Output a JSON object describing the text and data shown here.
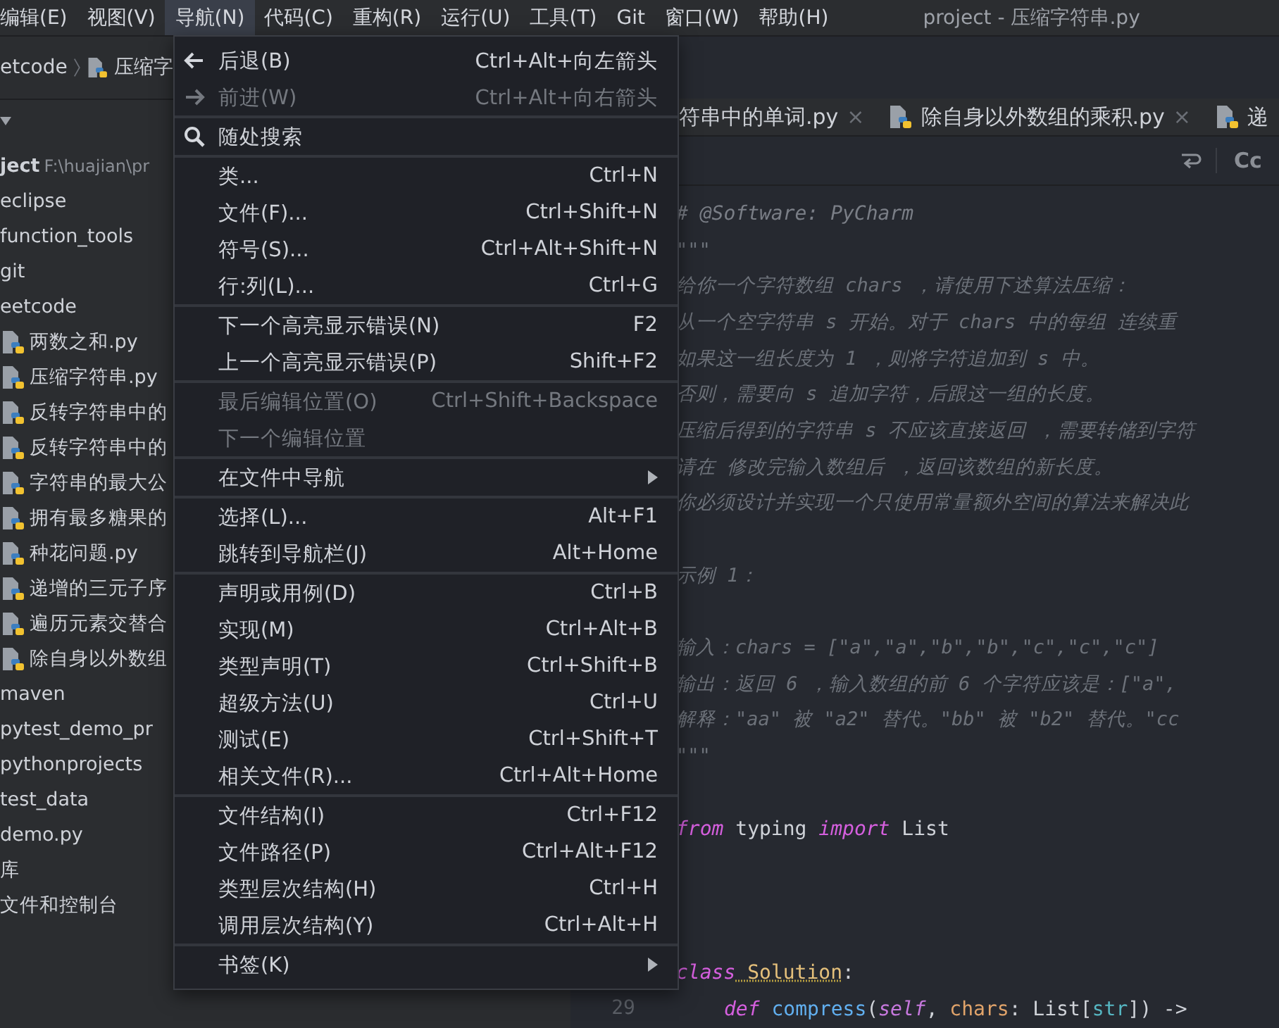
{
  "menu_bar": {
    "items": [
      {
        "label": "编辑(E)",
        "selected": false
      },
      {
        "label": "视图(V)",
        "selected": false
      },
      {
        "label": "导航(N)",
        "selected": true
      },
      {
        "label": "代码(C)",
        "selected": false
      },
      {
        "label": "重构(R)",
        "selected": false
      },
      {
        "label": "运行(U)",
        "selected": false
      },
      {
        "label": "工具(T)",
        "selected": false
      },
      {
        "label": "Git",
        "selected": false
      },
      {
        "label": "窗口(W)",
        "selected": false
      },
      {
        "label": "帮助(H)",
        "selected": false
      }
    ],
    "title": "project - 压缩字符串.py"
  },
  "breadcrumb": [
    "etcode",
    "压缩字"
  ],
  "project_tree": {
    "root": {
      "name": "ject",
      "path": "F:\\huajian\\pr",
      "children": [
        {
          "name": "eclipse"
        },
        {
          "name": "function_tools"
        },
        {
          "name": "git"
        },
        {
          "name": "eetcode",
          "children": [
            {
              "name": "两数之和.py",
              "kind": "python"
            },
            {
              "name": "压缩字符串.py",
              "kind": "python"
            },
            {
              "name": "反转字符串中的",
              "kind": "python"
            },
            {
              "name": "反转字符串中的",
              "kind": "python"
            },
            {
              "name": "字符串的最大公",
              "kind": "python"
            },
            {
              "name": "拥有最多糖果的",
              "kind": "python"
            },
            {
              "name": "种花问题.py",
              "kind": "python"
            },
            {
              "name": "递增的三元子序",
              "kind": "python"
            },
            {
              "name": "遍历元素交替合",
              "kind": "python"
            },
            {
              "name": "除自身以外数组",
              "kind": "python"
            }
          ]
        },
        {
          "name": "maven"
        },
        {
          "name": "pytest_demo_pr"
        },
        {
          "name": "pythonprojects"
        },
        {
          "name": "test_data"
        },
        {
          "name": "demo.py"
        }
      ]
    },
    "extra": [
      {
        "name": "库"
      },
      {
        "name": "文件和控制台"
      }
    ]
  },
  "editor_tabs": [
    {
      "label": "符串中的单词.py",
      "kind": "plain",
      "close": "×"
    },
    {
      "label": "除自身以外数组的乘积.py",
      "kind": "python",
      "close": "×"
    },
    {
      "label": "递",
      "kind": "python"
    }
  ],
  "editor_toolbar": {
    "case_button": "Cc"
  },
  "code": {
    "lines": [
      {
        "kind": "code",
        "tokens": [
          {
            "kind": "comment",
            "text": "# @Software: PyCharm"
          }
        ]
      },
      {
        "kind": "code",
        "tokens": [
          {
            "kind": "doc",
            "text": "\"\"\""
          }
        ]
      },
      {
        "kind": "code",
        "tokens": [
          {
            "kind": "doc",
            "text": "给你一个字符数组 chars ，请使用下述算法压缩："
          }
        ]
      },
      {
        "kind": "code",
        "tokens": [
          {
            "kind": "doc",
            "text": "从一个空字符串 s 开始。对于 chars 中的每组 连续重"
          }
        ]
      },
      {
        "kind": "code",
        "tokens": [
          {
            "kind": "doc",
            "text": "如果这一组长度为 1 ，则将字符追加到 s 中。"
          }
        ]
      },
      {
        "kind": "code",
        "tokens": [
          {
            "kind": "doc",
            "text": "否则，需要向 s 追加字符，后跟这一组的长度。"
          }
        ]
      },
      {
        "kind": "code",
        "tokens": [
          {
            "kind": "doc",
            "text": "压缩后得到的字符串 s 不应该直接返回 ，需要转储到字符"
          }
        ]
      },
      {
        "kind": "code",
        "tokens": [
          {
            "kind": "doc",
            "text": "请在 修改完输入数组后 ，返回该数组的新长度。"
          }
        ]
      },
      {
        "kind": "code",
        "tokens": [
          {
            "kind": "doc",
            "text": "你必须设计并实现一个只使用常量额外空间的算法来解决此"
          }
        ]
      },
      {
        "kind": "blank"
      },
      {
        "kind": "code",
        "tokens": [
          {
            "kind": "doc",
            "text": "示例 1："
          }
        ]
      },
      {
        "kind": "blank"
      },
      {
        "kind": "code",
        "tokens": [
          {
            "kind": "doc",
            "text": "输入：chars = [\"a\",\"a\",\"b\",\"b\",\"c\",\"c\",\"c\"]"
          }
        ]
      },
      {
        "kind": "code",
        "tokens": [
          {
            "kind": "doc",
            "text": "输出：返回 6 ，输入数组的前 6 个字符应该是：[\"a\","
          }
        ]
      },
      {
        "kind": "code",
        "tokens": [
          {
            "kind": "doc",
            "text": "解释：\"aa\" 被 \"a2\" 替代。\"bb\" 被 \"b2\" 替代。\"cc"
          }
        ]
      },
      {
        "kind": "code",
        "tokens": [
          {
            "kind": "doc",
            "text": "\"\"\""
          }
        ]
      },
      {
        "kind": "blank"
      },
      {
        "kind": "code",
        "tokens": [
          {
            "kind": "keyword",
            "text": "from"
          },
          {
            "kind": "plain",
            "text": " typing "
          },
          {
            "kind": "keyword",
            "text": "import"
          },
          {
            "kind": "plain",
            "text": " List"
          }
        ]
      },
      {
        "kind": "blank"
      },
      {
        "kind": "blank"
      },
      {
        "kind": "blank"
      },
      {
        "kind": "code",
        "tokens": [
          {
            "kind": "keyword",
            "text": "class"
          },
          {
            "kind": "classname",
            "text": " Solution"
          },
          {
            "kind": "plain",
            "text": ":"
          }
        ]
      },
      {
        "kind": "indented",
        "number": "29",
        "tokens": [
          {
            "kind": "keyword",
            "text": "def"
          },
          {
            "kind": "function",
            "text": " compress"
          },
          {
            "kind": "plain",
            "text": "("
          },
          {
            "kind": "self",
            "text": "self"
          },
          {
            "kind": "plain",
            "text": ", "
          },
          {
            "kind": "param",
            "text": "chars"
          },
          {
            "kind": "plain",
            "text": ": List["
          },
          {
            "kind": "builtin",
            "text": "str"
          },
          {
            "kind": "plain",
            "text": "]) ->"
          }
        ]
      }
    ]
  },
  "navigate_menu": {
    "groups": [
      {
        "items": [
          {
            "label": "后退(B)",
            "shortcut": "Ctrl+Alt+向左箭头",
            "disabled": false
          },
          {
            "label": "前进(W)",
            "shortcut": "Ctrl+Alt+向右箭头",
            "disabled": true
          }
        ]
      },
      {
        "items": [
          {
            "label": "随处搜索",
            "disabled": false
          }
        ]
      },
      {
        "items": [
          {
            "label": "类...",
            "shortcut": "Ctrl+N",
            "disabled": false
          },
          {
            "label": "文件(F)...",
            "shortcut": "Ctrl+Shift+N",
            "disabled": false
          },
          {
            "label": "符号(S)...",
            "shortcut": "Ctrl+Alt+Shift+N",
            "disabled": false
          },
          {
            "label": "行:列(L)...",
            "shortcut": "Ctrl+G",
            "disabled": false
          }
        ]
      },
      {
        "items": [
          {
            "label": "下一个高亮显示错误(N)",
            "shortcut": "F2",
            "disabled": false
          },
          {
            "label": "上一个高亮显示错误(P)",
            "shortcut": "Shift+F2",
            "disabled": false
          }
        ]
      },
      {
        "items": [
          {
            "label": "最后编辑位置(O)",
            "shortcut": "Ctrl+Shift+Backspace",
            "disabled": true
          },
          {
            "label": "下一个编辑位置",
            "disabled": true
          }
        ]
      },
      {
        "items": [
          {
            "label": "在文件中导航",
            "submenu": true,
            "disabled": false
          }
        ]
      },
      {
        "items": [
          {
            "label": "选择(L)...",
            "shortcut": "Alt+F1",
            "disabled": false
          },
          {
            "label": "跳转到导航栏(J)",
            "shortcut": "Alt+Home",
            "disabled": false
          }
        ]
      },
      {
        "items": [
          {
            "label": "声明或用例(D)",
            "shortcut": "Ctrl+B",
            "disabled": false
          },
          {
            "label": "实现(M)",
            "shortcut": "Ctrl+Alt+B",
            "disabled": false
          },
          {
            "label": "类型声明(T)",
            "shortcut": "Ctrl+Shift+B",
            "disabled": false
          },
          {
            "label": "超级方法(U)",
            "shortcut": "Ctrl+U",
            "disabled": false
          },
          {
            "label": "测试(E)",
            "shortcut": "Ctrl+Shift+T",
            "disabled": false
          },
          {
            "label": "相关文件(R)...",
            "shortcut": "Ctrl+Alt+Home",
            "disabled": false
          }
        ]
      },
      {
        "items": [
          {
            "label": "文件结构(I)",
            "shortcut": "Ctrl+F12",
            "disabled": false
          },
          {
            "label": "文件路径(P)",
            "shortcut": "Ctrl+Alt+F12",
            "disabled": false
          },
          {
            "label": "类型层次结构(H)",
            "shortcut": "Ctrl+H",
            "disabled": false
          },
          {
            "label": "调用层次结构(Y)",
            "shortcut": "Ctrl+Alt+H",
            "disabled": false
          }
        ]
      },
      {
        "items": [
          {
            "label": "书签(K)",
            "submenu": true,
            "disabled": false
          }
        ]
      }
    ]
  }
}
